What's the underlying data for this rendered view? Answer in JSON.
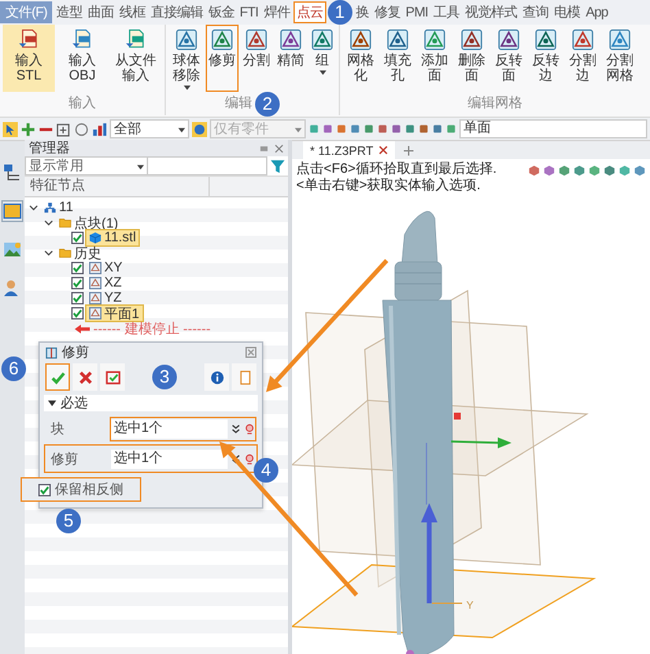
{
  "menu_tabs": [
    {
      "label": "文件(F)",
      "kind": "file",
      "selected": false,
      "highlighted": false
    },
    {
      "label": "造型",
      "kind": "tab",
      "selected": false,
      "highlighted": false
    },
    {
      "label": "曲面",
      "kind": "tab",
      "selected": false,
      "highlighted": false
    },
    {
      "label": "线框",
      "kind": "tab",
      "selected": false,
      "highlighted": false
    },
    {
      "label": "直接编辑",
      "kind": "tab",
      "selected": false,
      "highlighted": false
    },
    {
      "label": "钣金",
      "kind": "tab",
      "selected": false,
      "highlighted": false
    },
    {
      "label": "FTI",
      "kind": "tab",
      "selected": false,
      "highlighted": false
    },
    {
      "label": "焊件",
      "kind": "tab",
      "selected": false,
      "highlighted": false
    },
    {
      "label": "点云",
      "kind": "tab",
      "selected": true,
      "highlighted": true
    },
    {
      "label": "换",
      "kind": "tab",
      "selected": false,
      "highlighted": false
    },
    {
      "label": "修复",
      "kind": "tab",
      "selected": false,
      "highlighted": false
    },
    {
      "label": "PMI",
      "kind": "tab",
      "selected": false,
      "highlighted": false
    },
    {
      "label": "工具",
      "kind": "tab",
      "selected": false,
      "highlighted": false
    },
    {
      "label": "视觉样式",
      "kind": "tab",
      "selected": false,
      "highlighted": false
    },
    {
      "label": "查询",
      "kind": "tab",
      "selected": false,
      "highlighted": false
    },
    {
      "label": "电模",
      "kind": "tab",
      "selected": false,
      "highlighted": false
    },
    {
      "label": "App",
      "kind": "tab",
      "selected": false,
      "highlighted": false
    }
  ],
  "ribbon_groups": [
    {
      "label": "输入",
      "buttons": [
        {
          "label": "输入STL",
          "kind": "file",
          "selected": true,
          "dropdown": false,
          "highlighted": false
        },
        {
          "label": "输入OBJ",
          "kind": "file",
          "selected": false,
          "dropdown": false,
          "highlighted": false
        },
        {
          "label": "从文件输入",
          "kind": "file",
          "selected": false,
          "dropdown": false,
          "highlighted": false
        }
      ]
    },
    {
      "label": "编辑",
      "buttons": [
        {
          "label": "球体移除",
          "kind": "mesh",
          "selected": false,
          "dropdown": true,
          "highlighted": false
        },
        {
          "label": "修剪",
          "kind": "mesh",
          "selected": false,
          "dropdown": false,
          "highlighted": true
        },
        {
          "label": "分割",
          "kind": "mesh",
          "selected": false,
          "dropdown": false,
          "highlighted": false
        },
        {
          "label": "精简",
          "kind": "mesh",
          "selected": false,
          "dropdown": false,
          "highlighted": false
        },
        {
          "label": "组",
          "kind": "mesh",
          "selected": false,
          "dropdown": true,
          "highlighted": false
        }
      ]
    },
    {
      "label": "编辑网格",
      "buttons": [
        {
          "label": "网格化",
          "kind": "mesh",
          "selected": false,
          "dropdown": false,
          "highlighted": false
        },
        {
          "label": "填充孔",
          "kind": "mesh",
          "selected": false,
          "dropdown": false,
          "highlighted": false
        },
        {
          "label": "添加面",
          "kind": "mesh",
          "selected": false,
          "dropdown": false,
          "highlighted": false
        },
        {
          "label": "删除面",
          "kind": "mesh",
          "selected": false,
          "dropdown": false,
          "highlighted": false
        },
        {
          "label": "反转面",
          "kind": "mesh",
          "selected": false,
          "dropdown": false,
          "highlighted": false
        },
        {
          "label": "反转边",
          "kind": "mesh",
          "selected": false,
          "dropdown": false,
          "highlighted": false
        },
        {
          "label": "分割边",
          "kind": "mesh",
          "selected": false,
          "dropdown": false,
          "highlighted": false
        },
        {
          "label": "分割网格",
          "kind": "mesh",
          "selected": false,
          "dropdown": false,
          "highlighted": false
        }
      ]
    }
  ],
  "toolbar": {
    "scope": "全部",
    "part_filter": {
      "label": "仅有零件",
      "disabled": true
    },
    "face_field": "单面"
  },
  "manager": {
    "title": "管理器",
    "filter": "显示常用",
    "column": "特征节点",
    "tree": [
      {
        "label": "11",
        "kind": "root",
        "expanded": true,
        "selected": false,
        "children": [
          {
            "label": "点块(1)",
            "kind": "folder",
            "expanded": true,
            "selected": false,
            "children": [
              {
                "label": "11.stl",
                "kind": "stl",
                "checked": true,
                "selected": true
              }
            ]
          },
          {
            "label": "历史",
            "kind": "folder",
            "expanded": true,
            "selected": false,
            "children": [
              {
                "label": "XY",
                "kind": "plane",
                "checked": true,
                "selected": false
              },
              {
                "label": "XZ",
                "kind": "plane",
                "checked": true,
                "selected": false
              },
              {
                "label": "YZ",
                "kind": "plane",
                "checked": true,
                "selected": false
              },
              {
                "label": "平面1",
                "kind": "plane",
                "checked": true,
                "selected": true
              },
              {
                "label": "------ 建模停止 ------",
                "kind": "stop",
                "selected": false
              }
            ]
          }
        ]
      }
    ]
  },
  "dialog": {
    "title": "修剪",
    "ok_highlighted": true,
    "section": "必选",
    "section_expanded": true,
    "fields": [
      {
        "label": "块",
        "value": "选中1个",
        "field_highlighted": true,
        "label_highlighted": false
      },
      {
        "label": "修剪",
        "value": "选中1个",
        "field_highlighted": true,
        "label_highlighted": true
      }
    ],
    "options": [
      {
        "label": "保留相反侧",
        "checked": true,
        "highlighted": true
      }
    ]
  },
  "viewport": {
    "tab": "* 11.Z3PRT",
    "hint": [
      "点击<F6>循环拾取直到最后选择.",
      "<单击右键>获取实体输入选项."
    ],
    "axis_label": "Y"
  },
  "annotations": [
    {
      "label": "1"
    },
    {
      "label": "2"
    },
    {
      "label": "3"
    },
    {
      "label": "4"
    },
    {
      "label": "5"
    },
    {
      "label": "6"
    }
  ]
}
